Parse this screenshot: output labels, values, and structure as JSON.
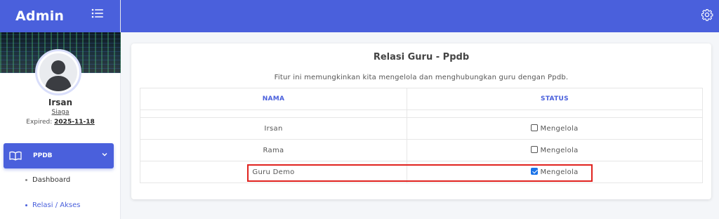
{
  "sidebar": {
    "brand": "Admin",
    "user": {
      "name": "Irsan",
      "role": "Siaga",
      "expired_label": "Expired:",
      "expired_date": "2025-11-18"
    },
    "nav": {
      "ppdb_label": "PPDB",
      "sub_items": [
        {
          "label": "Dashboard",
          "active": false
        },
        {
          "label": "Relasi / Akses",
          "active": true
        }
      ]
    }
  },
  "topbar": {
    "icon": "gear-icon"
  },
  "card": {
    "title": "Relasi Guru - Ppdb",
    "description": "Fitur ini memungkinkan kita mengelola dan menghubungkan guru dengan Ppdb.",
    "table": {
      "headers": [
        "NAMA",
        "STATUS"
      ],
      "rows": [
        {
          "nama": "Irsan",
          "status_label": "Mengelola",
          "checked": false
        },
        {
          "nama": "Rama",
          "status_label": "Mengelola",
          "checked": false
        },
        {
          "nama": "Guru Demo",
          "status_label": "Mengelola",
          "checked": true
        }
      ]
    }
  },
  "colors": {
    "primary": "#4a60dc",
    "highlight": "#e0231f",
    "checkbox_checked": "#1a73e8"
  }
}
